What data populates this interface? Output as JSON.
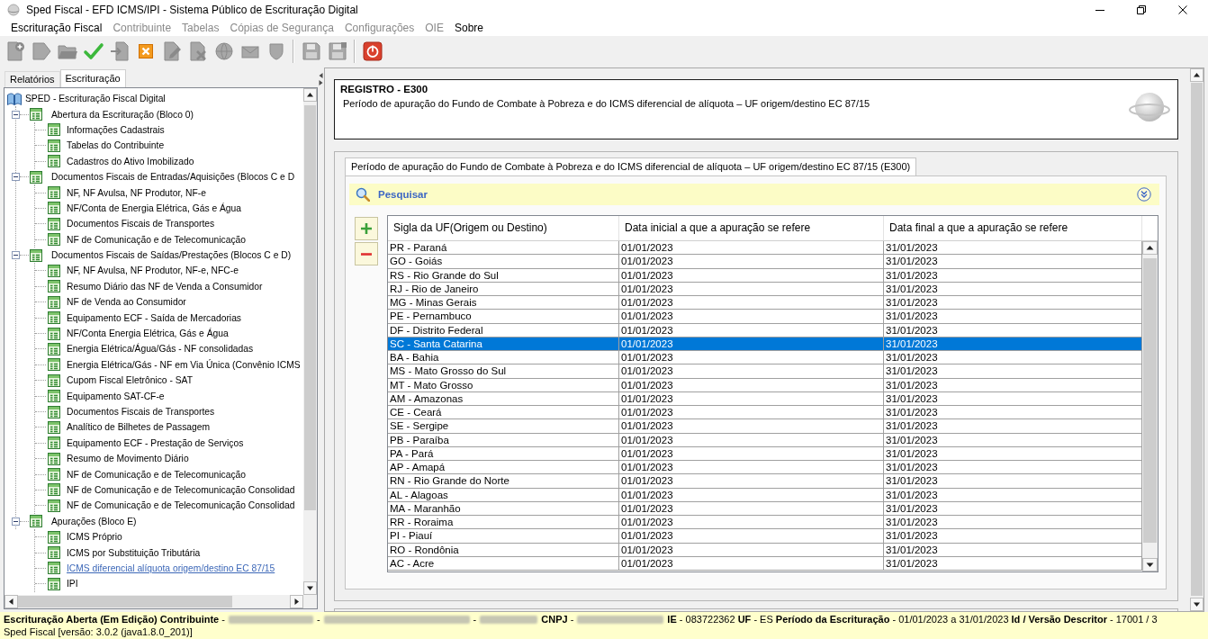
{
  "window": {
    "title": "Sped Fiscal - EFD ICMS/IPI - Sistema Público de Escrituração Digital"
  },
  "menu": [
    {
      "label": "Escrituração Fiscal",
      "disabled": false
    },
    {
      "label": "Contribuinte",
      "disabled": true
    },
    {
      "label": "Tabelas",
      "disabled": true
    },
    {
      "label": "Cópias de Segurança",
      "disabled": true
    },
    {
      "label": "Configurações",
      "disabled": true
    },
    {
      "label": "OIE",
      "disabled": true
    },
    {
      "label": "Sobre",
      "disabled": false
    }
  ],
  "toolbar": [
    {
      "kind": "doc-plus",
      "disabled": true
    },
    {
      "kind": "doc-arrow",
      "disabled": true
    },
    {
      "kind": "folder",
      "disabled": true
    },
    {
      "kind": "check",
      "disabled": false
    },
    {
      "kind": "import",
      "disabled": true
    },
    {
      "kind": "delete",
      "disabled": false
    },
    {
      "kind": "edit-doc",
      "disabled": true
    },
    {
      "kind": "delete-doc",
      "disabled": true
    },
    {
      "kind": "globe",
      "disabled": true
    },
    {
      "kind": "mail",
      "disabled": true
    },
    {
      "kind": "shield",
      "disabled": true
    },
    {
      "kind": "separator"
    },
    {
      "kind": "save",
      "disabled": true
    },
    {
      "kind": "save-as",
      "disabled": true
    },
    {
      "kind": "separator"
    },
    {
      "kind": "power",
      "disabled": false
    }
  ],
  "left_tabs": [
    {
      "label": "Relatórios",
      "selected": false
    },
    {
      "label": "Escrituração",
      "selected": true
    }
  ],
  "tree": {
    "label": "SPED - Escrituração Fiscal Digital",
    "selected": false,
    "children": [
      {
        "label": "Abertura da Escrituração (Bloco 0)",
        "expanded": true,
        "selected": false,
        "children": [
          {
            "label": "Informações Cadastrais",
            "selected": false
          },
          {
            "label": "Tabelas do Contribuinte",
            "selected": false
          },
          {
            "label": "Cadastros do Ativo Imobilizado",
            "selected": false
          }
        ]
      },
      {
        "label": "Documentos Fiscais de Entradas/Aquisições (Blocos C e D",
        "expanded": true,
        "selected": false,
        "children": [
          {
            "label": "NF, NF Avulsa, NF Produtor, NF-e",
            "selected": false
          },
          {
            "label": "NF/Conta de Energia Elétrica, Gás e Água",
            "selected": false
          },
          {
            "label": "Documentos Fiscais de Transportes",
            "selected": false
          },
          {
            "label": "NF de Comunicação e de Telecomunicação",
            "selected": false
          }
        ]
      },
      {
        "label": "Documentos Fiscais de Saídas/Prestações (Blocos C e D)",
        "expanded": true,
        "selected": false,
        "children": [
          {
            "label": "NF, NF Avulsa, NF Produtor, NF-e, NFC-e",
            "selected": false
          },
          {
            "label": "Resumo Diário das NF de Venda a Consumidor",
            "selected": false
          },
          {
            "label": "NF de Venda ao Consumidor",
            "selected": false
          },
          {
            "label": "Equipamento ECF - Saída de Mercadorias",
            "selected": false
          },
          {
            "label": "NF/Conta Energia Elétrica, Gás e Água",
            "selected": false
          },
          {
            "label": "Energia Elétrica/Água/Gás - NF consolidadas",
            "selected": false
          },
          {
            "label": "Energia Elétrica/Gás - NF em Via Única (Convênio ICMS",
            "selected": false
          },
          {
            "label": "Cupom Fiscal Eletrônico - SAT",
            "selected": false
          },
          {
            "label": "Equipamento SAT-CF-e",
            "selected": false
          },
          {
            "label": "Documentos Fiscais de Transportes",
            "selected": false
          },
          {
            "label": "Analítico de Bilhetes de Passagem",
            "selected": false
          },
          {
            "label": "Equipamento ECF - Prestação de Serviços",
            "selected": false
          },
          {
            "label": "Resumo de Movimento Diário",
            "selected": false
          },
          {
            "label": "NF de Comunicação e de Telecomunicação",
            "selected": false
          },
          {
            "label": "NF de Comunicação e de Telecomunicação Consolidad",
            "selected": false
          },
          {
            "label": "NF de Comunicação e de Telecomunicação Consolidad",
            "selected": false
          }
        ]
      },
      {
        "label": "Apurações (Bloco E)",
        "expanded": true,
        "selected": false,
        "children": [
          {
            "label": "ICMS Próprio",
            "selected": false
          },
          {
            "label": "ICMS por Substituição Tributária",
            "selected": false
          },
          {
            "label": "ICMS diferencial alíquota origem/destino EC 87/15",
            "selected": true
          },
          {
            "label": "IPI",
            "selected": false
          }
        ]
      }
    ]
  },
  "record": {
    "title": "REGISTRO - E300",
    "description": "Período de apuração do Fundo de Combate à Pobreza e do ICMS diferencial de alíquota – UF origem/destino EC 87/15"
  },
  "form_tabs": [
    {
      "label": "Período de apuração do Fundo de Combate à Pobreza e do ICMS diferencial de alíquota – UF origem/destino EC 87/15 (E300)",
      "selected": true
    }
  ],
  "search_bar": {
    "label": "Pesquisar",
    "expanded": false
  },
  "table": {
    "columns": [
      "Sigla da UF(Origem ou Destino)",
      "Data inicial a que a apuração se refere",
      "Data final a que a apuração se refere"
    ],
    "rows": [
      {
        "cells": [
          "PR - Paraná",
          "01/01/2023",
          "31/01/2023"
        ],
        "selected": false
      },
      {
        "cells": [
          "GO - Goiás",
          "01/01/2023",
          "31/01/2023"
        ],
        "selected": false
      },
      {
        "cells": [
          "RS - Rio Grande do Sul",
          "01/01/2023",
          "31/01/2023"
        ],
        "selected": false
      },
      {
        "cells": [
          "RJ - Rio de Janeiro",
          "01/01/2023",
          "31/01/2023"
        ],
        "selected": false
      },
      {
        "cells": [
          "MG - Minas Gerais",
          "01/01/2023",
          "31/01/2023"
        ],
        "selected": false
      },
      {
        "cells": [
          "PE - Pernambuco",
          "01/01/2023",
          "31/01/2023"
        ],
        "selected": false
      },
      {
        "cells": [
          "DF - Distrito Federal",
          "01/01/2023",
          "31/01/2023"
        ],
        "selected": false
      },
      {
        "cells": [
          "SC - Santa Catarina",
          "01/01/2023",
          "31/01/2023"
        ],
        "selected": true
      },
      {
        "cells": [
          "BA - Bahia",
          "01/01/2023",
          "31/01/2023"
        ],
        "selected": false
      },
      {
        "cells": [
          "MS - Mato Grosso do Sul",
          "01/01/2023",
          "31/01/2023"
        ],
        "selected": false
      },
      {
        "cells": [
          "MT - Mato Grosso",
          "01/01/2023",
          "31/01/2023"
        ],
        "selected": false
      },
      {
        "cells": [
          "AM - Amazonas",
          "01/01/2023",
          "31/01/2023"
        ],
        "selected": false
      },
      {
        "cells": [
          "CE - Ceará",
          "01/01/2023",
          "31/01/2023"
        ],
        "selected": false
      },
      {
        "cells": [
          "SE - Sergipe",
          "01/01/2023",
          "31/01/2023"
        ],
        "selected": false
      },
      {
        "cells": [
          "PB - Paraíba",
          "01/01/2023",
          "31/01/2023"
        ],
        "selected": false
      },
      {
        "cells": [
          "PA - Pará",
          "01/01/2023",
          "31/01/2023"
        ],
        "selected": false
      },
      {
        "cells": [
          "AP - Amapá",
          "01/01/2023",
          "31/01/2023"
        ],
        "selected": false
      },
      {
        "cells": [
          "RN - Rio Grande do Norte",
          "01/01/2023",
          "31/01/2023"
        ],
        "selected": false
      },
      {
        "cells": [
          "AL - Alagoas",
          "01/01/2023",
          "31/01/2023"
        ],
        "selected": false
      },
      {
        "cells": [
          "MA - Maranhão",
          "01/01/2023",
          "31/01/2023"
        ],
        "selected": false
      },
      {
        "cells": [
          "RR - Roraima",
          "01/01/2023",
          "31/01/2023"
        ],
        "selected": false
      },
      {
        "cells": [
          "PI - Piauí",
          "01/01/2023",
          "31/01/2023"
        ],
        "selected": false
      },
      {
        "cells": [
          "RO - Rondônia",
          "01/01/2023",
          "31/01/2023"
        ],
        "selected": false
      },
      {
        "cells": [
          "AC - Acre",
          "01/01/2023",
          "31/01/2023"
        ],
        "selected": false
      }
    ]
  },
  "status_bar": {
    "line_1": [
      {
        "kind": "text",
        "text": "**Escrituração Aberta (Em Edição) Contribuinte** -"
      },
      {
        "kind": "redacted"
      },
      {
        "kind": "text",
        "text": "-"
      },
      {
        "kind": "redacted"
      },
      {
        "kind": "text",
        "text": "-"
      },
      {
        "kind": "redacted"
      },
      {
        "kind": "text",
        "text": "**CNPJ** -"
      },
      {
        "kind": "redacted"
      },
      {
        "kind": "text",
        "text": "**IE** - 083722362 **UF** - ES **Período da Escrituração** - 01/01/2023 a 31/01/2023 **Id / Versão Descritor** - 17001 / 3"
      }
    ],
    "line_2": "Sped Fiscal [versão: 3.0.2 (java1.8.0_201)]"
  }
}
